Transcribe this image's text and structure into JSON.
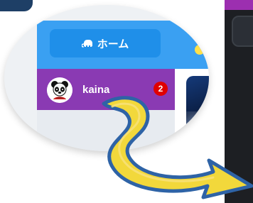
{
  "header": {
    "home_label": "ホーム"
  },
  "user": {
    "name": "kaina",
    "notification_count": "2"
  },
  "icons": {
    "home_button_icon": "elephant-icon",
    "avatar_icon": "panda-avatar-icon",
    "callout_arrow": "curved-arrow-icon"
  },
  "colors": {
    "header_blue": "#3aa0f2",
    "home_button_blue": "#1f8fe9",
    "user_row_purple": "#8a3ab3",
    "badge_red": "#e00000",
    "arrow_yellow": "#f2d83b",
    "arrow_outline_blue": "#2e63a6",
    "right_panel_dark": "#1d1f23",
    "right_panel_magenta": "#9c2fb0"
  }
}
